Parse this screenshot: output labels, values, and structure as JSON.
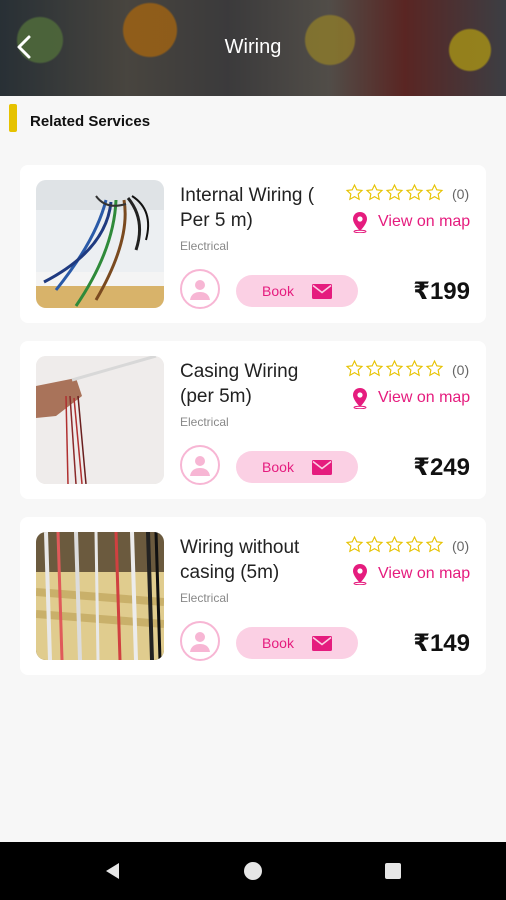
{
  "header": {
    "title": "Wiring",
    "back_icon": "back-arrow-icon"
  },
  "section": {
    "title": "Related Services"
  },
  "colors": {
    "accent": "#e51c7e",
    "accent_light": "#fbd0e4",
    "star": "#e6c200",
    "section_bar": "#e6c200"
  },
  "services": [
    {
      "name": "Internal Wiring ( Per 5 m)",
      "category": "Electrical",
      "rating_stars": 0,
      "rating_count": "(0)",
      "map_label": "View on map",
      "book_label": "Book",
      "price": "₹199"
    },
    {
      "name": "Casing Wiring (per 5m)",
      "category": "Electrical",
      "rating_stars": 0,
      "rating_count": "(0)",
      "map_label": "View on map",
      "book_label": "Book",
      "price": "₹249"
    },
    {
      "name": "Wiring without casing (5m)",
      "category": "Electrical",
      "rating_stars": 0,
      "rating_count": "(0)",
      "map_label": "View on map",
      "book_label": "Book",
      "price": "₹149"
    }
  ],
  "navbar": {
    "icons": [
      "nav-back-icon",
      "nav-home-icon",
      "nav-recents-icon"
    ]
  }
}
